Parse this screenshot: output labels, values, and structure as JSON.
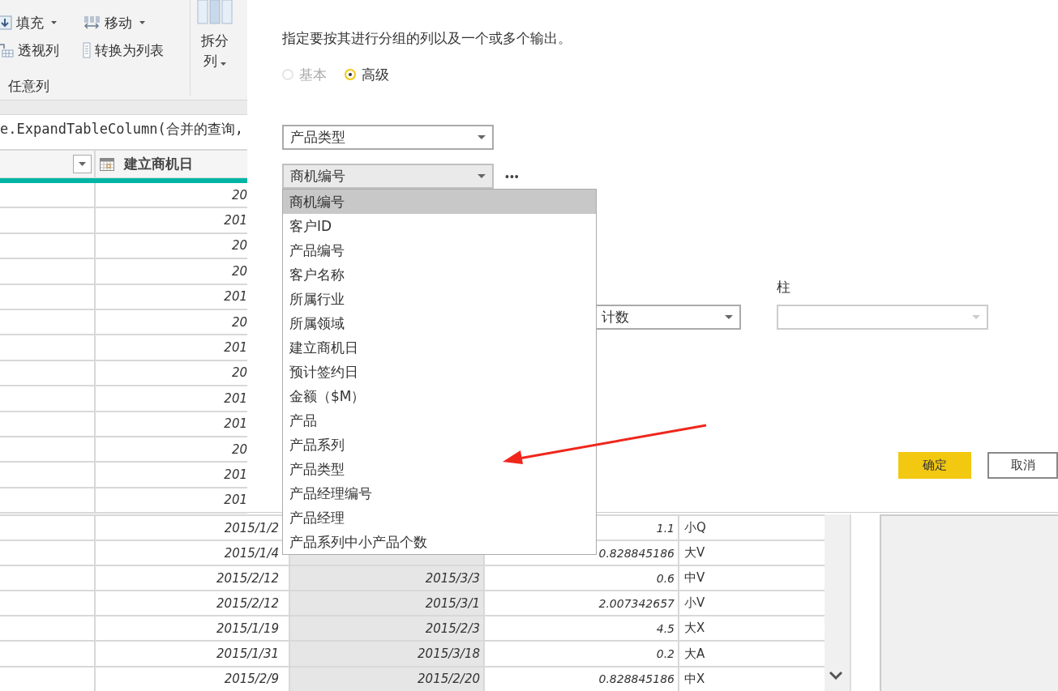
{
  "ribbon": {
    "commands": [
      {
        "label": "填充",
        "has_menu": true
      },
      {
        "label": "移动",
        "has_menu": true
      },
      {
        "label": "透视列",
        "has_menu": false
      },
      {
        "label": "转换为列表",
        "has_menu": false
      }
    ],
    "split_button": {
      "label": "拆分列",
      "has_menu": true
    },
    "group_label": "任意列"
  },
  "formula_bar": {
    "text": "e.ExpandTableColumn(合并的查询,"
  },
  "grid": {
    "column_2_header": "建立商机日",
    "upper_rows": [
      {
        "column_2": "20"
      },
      {
        "column_2": "201"
      },
      {
        "column_2": "20"
      },
      {
        "column_2": "20"
      },
      {
        "column_2": "201"
      },
      {
        "column_2": "20"
      },
      {
        "column_2": "201"
      },
      {
        "column_2": "20"
      },
      {
        "column_2": "201"
      },
      {
        "column_2": "201"
      },
      {
        "column_2": "20"
      },
      {
        "column_2": "201"
      },
      {
        "column_2": "201"
      }
    ],
    "lower_rows": [
      {
        "column_2": "2015/1/2",
        "column_4": "1.1",
        "column_5": "小Q"
      },
      {
        "column_2": "2015/1/4",
        "column_4": "0.828845186",
        "column_5": "大V"
      },
      {
        "column_2": "2015/2/12",
        "column_3": "2015/3/3",
        "column_4": "0.6",
        "column_5": "中V"
      },
      {
        "column_2": "2015/2/12",
        "column_3": "2015/3/1",
        "column_4": "2.007342657",
        "column_5": "小V"
      },
      {
        "column_2": "2015/1/19",
        "column_3": "2015/2/3",
        "column_4": "4.5",
        "column_5": "大X"
      },
      {
        "column_2": "2015/1/31",
        "column_3": "2015/3/18",
        "column_4": "0.2",
        "column_5": "大A"
      },
      {
        "column_2": "2015/2/9",
        "column_3": "2015/2/20",
        "column_4": "0.828845186",
        "column_5": "中X"
      }
    ]
  },
  "dialog": {
    "description": "指定要按其进行分组的列以及一个或多个输出。",
    "modes": [
      {
        "label": "基本",
        "selected": false,
        "disabled": true
      },
      {
        "label": "高级",
        "selected": true,
        "disabled": false
      }
    ],
    "group_by": [
      {
        "value": "产品类型",
        "open": false
      },
      {
        "value": "商机编号",
        "open": true
      }
    ],
    "more_button": "•••",
    "options": [
      {
        "label": "商机编号",
        "selected": true
      },
      {
        "label": "客户ID",
        "selected": false
      },
      {
        "label": "产品编号",
        "selected": false
      },
      {
        "label": "客户名称",
        "selected": false
      },
      {
        "label": "所属行业",
        "selected": false
      },
      {
        "label": "所属领域",
        "selected": false
      },
      {
        "label": "建立商机日",
        "selected": false
      },
      {
        "label": "预计签约日",
        "selected": false
      },
      {
        "label": "金额（$M）",
        "selected": false
      },
      {
        "label": "产品",
        "selected": false
      },
      {
        "label": "产品系列",
        "selected": false
      },
      {
        "label": "产品类型",
        "selected": false
      },
      {
        "label": "产品经理编号",
        "selected": false
      },
      {
        "label": "产品经理",
        "selected": false
      },
      {
        "label": "产品系列中小产品个数",
        "selected": false
      }
    ],
    "aggregation": {
      "operation": "计数",
      "column_label": "柱",
      "column_disabled": true
    },
    "buttons": [
      {
        "label": "确定",
        "primary": true
      },
      {
        "label": "取消",
        "primary": false
      }
    ]
  }
}
